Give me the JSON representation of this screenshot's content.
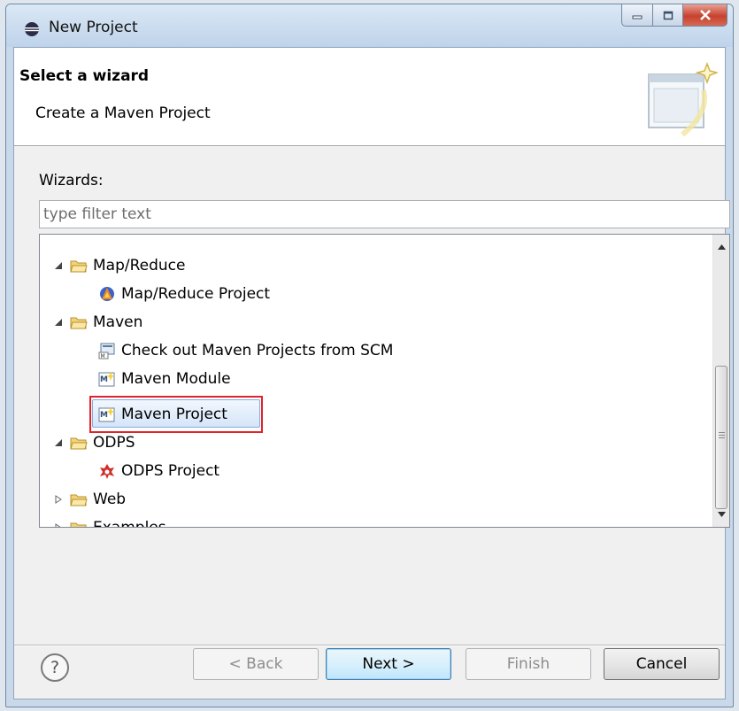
{
  "window": {
    "title": "New Project"
  },
  "banner": {
    "title": "Select a wizard",
    "description": "Create a Maven Project"
  },
  "wizards": {
    "label": "Wizards:",
    "filter_placeholder": "type filter text",
    "tree": [
      {
        "label": "Map/Reduce",
        "level": 0,
        "expanded": true,
        "icon": "folder-icon"
      },
      {
        "label": "Map/Reduce Project",
        "level": 1,
        "icon": "mapreduce-project-icon"
      },
      {
        "label": "Maven",
        "level": 0,
        "expanded": true,
        "icon": "folder-icon"
      },
      {
        "label": "Check out Maven Projects from SCM",
        "level": 1,
        "icon": "maven-scm-icon"
      },
      {
        "label": "Maven Module",
        "level": 1,
        "icon": "maven-module-icon"
      },
      {
        "label": "Maven Project",
        "level": 1,
        "icon": "maven-project-icon",
        "selected": true
      },
      {
        "label": "ODPS",
        "level": 0,
        "expanded": true,
        "icon": "folder-icon"
      },
      {
        "label": "ODPS Project",
        "level": 1,
        "icon": "odps-project-icon"
      },
      {
        "label": "Web",
        "level": 0,
        "expanded": false,
        "icon": "folder-icon"
      },
      {
        "label": "Examples",
        "level": 0,
        "expanded": false,
        "icon": "folder-icon"
      }
    ]
  },
  "buttons": {
    "help": "?",
    "back": "< Back",
    "next": "Next >",
    "finish": "Finish",
    "cancel": "Cancel"
  },
  "colors": {
    "highlight": "#e0222b",
    "selection": "#d5e5f8",
    "titlebar": "#c9d9ea"
  }
}
